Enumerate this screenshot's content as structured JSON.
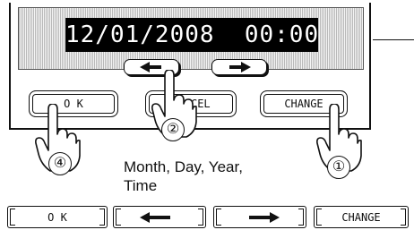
{
  "display": {
    "datetime": "12/01/2008  00:00"
  },
  "panel_buttons": {
    "ok_label": "O K",
    "cancel_label": "CANCEL",
    "change_label": "CHANGE",
    "left_arrow_icon": "left-arrow-icon",
    "right_arrow_icon": "right-arrow-icon"
  },
  "steps": {
    "step1": "①",
    "step2": "②",
    "step4": "④"
  },
  "note": "Month, Day, Year,\nTime",
  "bottom_buttons": {
    "ok_label": "O K",
    "change_label": "CHANGE",
    "left_arrow_icon": "left-arrow-icon",
    "right_arrow_icon": "right-arrow-icon"
  }
}
